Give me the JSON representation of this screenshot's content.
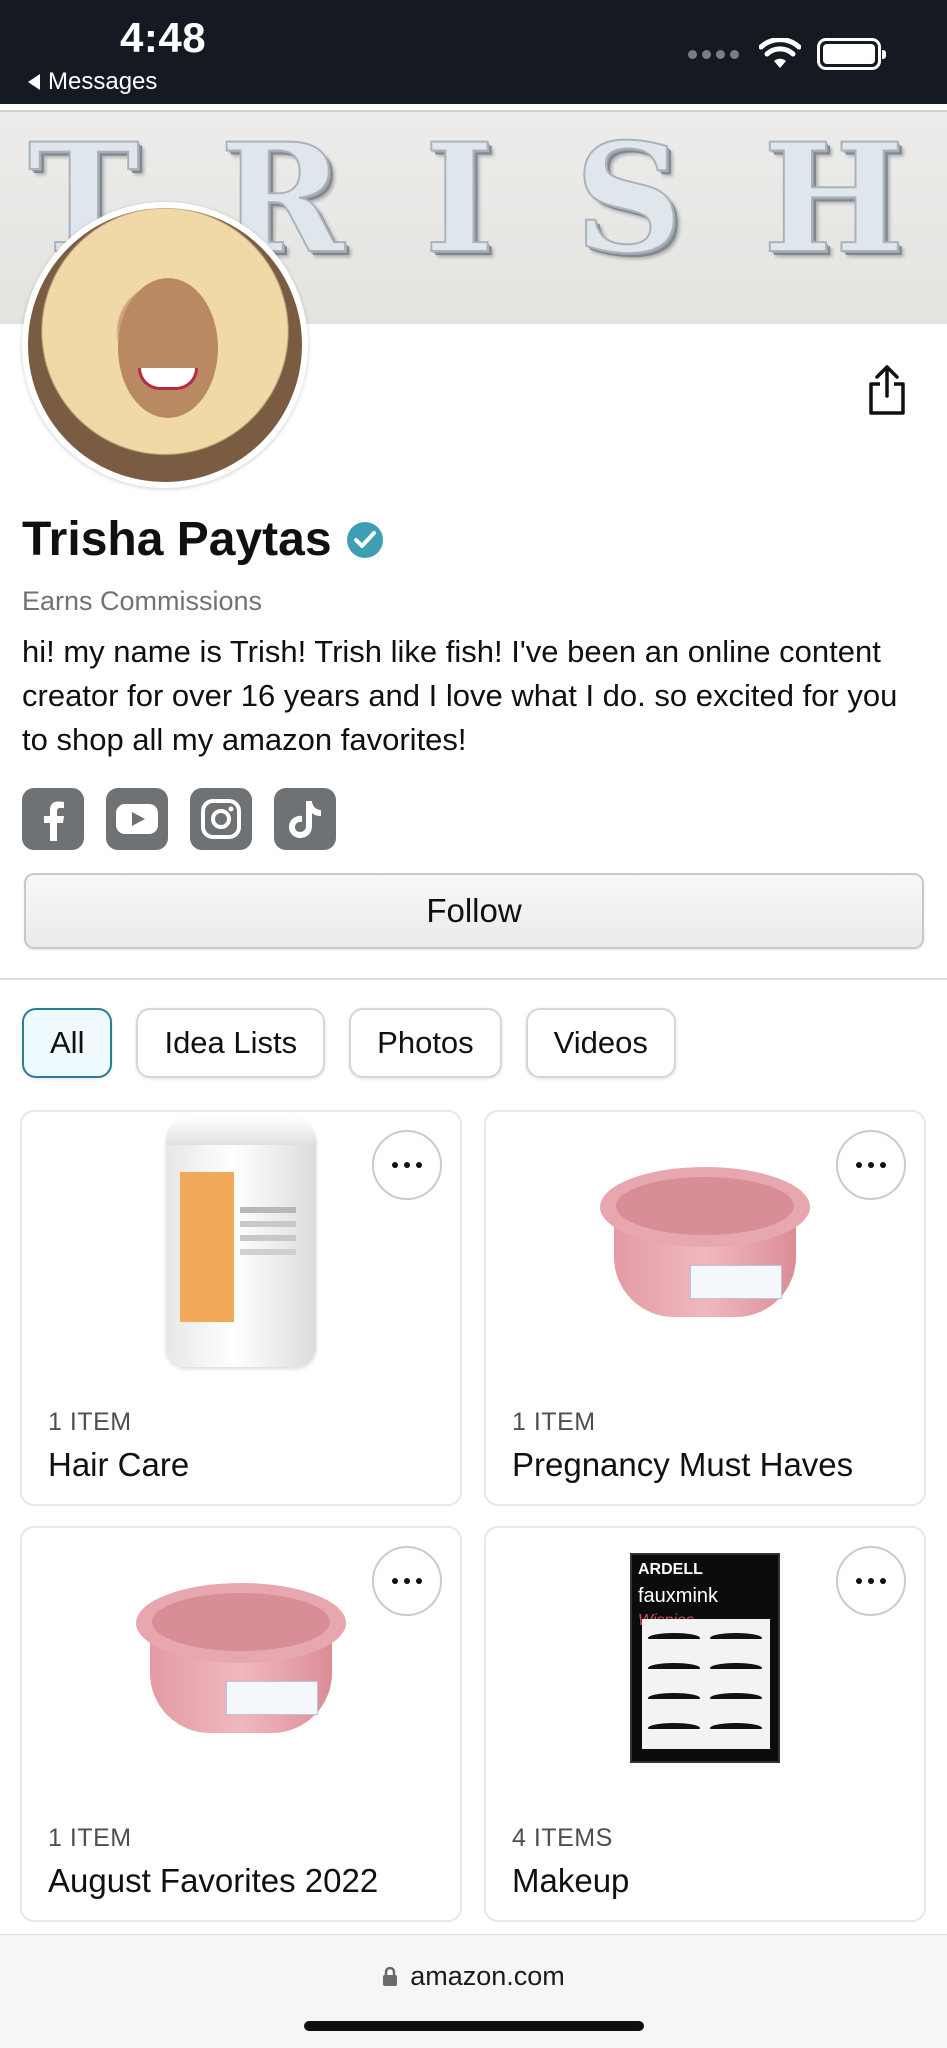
{
  "status_bar": {
    "time": "4:48",
    "back_label": "Messages"
  },
  "cover": {
    "title": "TRISHA"
  },
  "profile": {
    "name": "Trisha Paytas",
    "subtitle": "Earns Commissions",
    "bio": "hi! my name is Trish! Trish like fish! I've been an online content creator for over 16 years and I love what I do. so excited for you to shop all my amazon favorites!",
    "socials": [
      "facebook-icon",
      "youtube-icon",
      "instagram-icon",
      "tiktok-icon"
    ],
    "follow_label": "Follow"
  },
  "tabs": [
    {
      "label": "All",
      "active": true
    },
    {
      "label": "Idea Lists",
      "active": false
    },
    {
      "label": "Photos",
      "active": false
    },
    {
      "label": "Videos",
      "active": false
    }
  ],
  "lists": [
    {
      "count": "1 ITEM",
      "title": "Hair Care"
    },
    {
      "count": "1 ITEM",
      "title": "Pregnancy Must Haves"
    },
    {
      "count": "1 ITEM",
      "title": "August Favorites 2022"
    },
    {
      "count": "4 ITEMS",
      "title": "Makeup"
    }
  ],
  "product_text": {
    "lash_brand": "ARDELL",
    "lash_line": "fauxmink",
    "lash_style": "Wispies"
  },
  "browser": {
    "url": "amazon.com"
  },
  "colors": {
    "accent": "#2b7e94",
    "status_bar": "#151a22",
    "verified": "#3d9eb4"
  }
}
